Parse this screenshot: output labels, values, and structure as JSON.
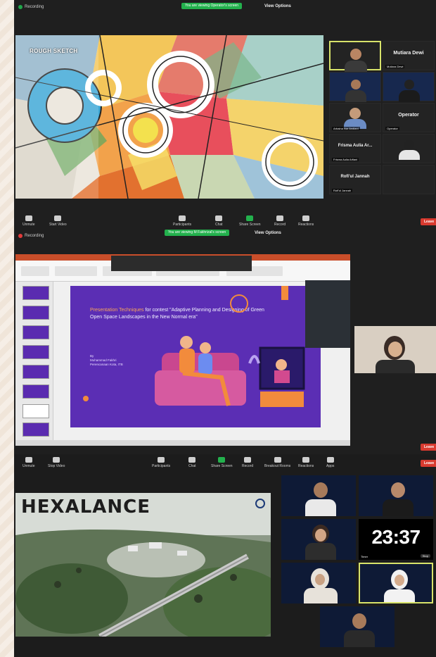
{
  "colors": {
    "zoom_bg": "#1f1f1f",
    "green": "#23b14d",
    "leave": "#d83a2f",
    "slide_purple": "#5b2eb4",
    "accent_orange": "#f6a35c",
    "active_border": "#d8e36a"
  },
  "panel1": {
    "recording": "Recording",
    "banner": "You are viewing Operator's screen",
    "view_options": "View Options",
    "share_label": "ROUGH SKETCH",
    "tiles": [
      {
        "name": "",
        "big": ""
      },
      {
        "name": "Mutiara Dewi",
        "big": "Mutiara Dewi"
      },
      {
        "name": "",
        "big": ""
      },
      {
        "name": "",
        "big": ""
      },
      {
        "name": "Arbaina Nur Andiani",
        "big": ""
      },
      {
        "name": "Operator",
        "big": "Operator"
      },
      {
        "name": "Frisma Aulia Arfiani",
        "big": "Frisma Aulia Ar..."
      },
      {
        "name": "",
        "big": ""
      },
      {
        "name": "Rofi'ul Jannah",
        "big": "Rofi'ul Jannah"
      },
      {
        "name": "",
        "big": ""
      }
    ],
    "toolbar": [
      {
        "label": "Unmute",
        "icon": "microphone-icon"
      },
      {
        "label": "Start Video",
        "icon": "video-camera-icon"
      },
      {
        "label": "Participants",
        "icon": "participants-icon"
      },
      {
        "label": "Chat",
        "icon": "chat-icon"
      },
      {
        "label": "Share Screen",
        "icon": "share-screen-icon"
      },
      {
        "label": "Record",
        "icon": "record-icon"
      },
      {
        "label": "Reactions",
        "icon": "reactions-icon"
      }
    ],
    "leave": "Leave"
  },
  "panel2": {
    "recording": "Recording",
    "banner": "You are viewing M Fakhrizal's screen",
    "view_options": "View Options",
    "slide": {
      "title_hl": "Presentation Techniques",
      "title_rest": " for contest \"Adaptive Planning and Designing of Green Open Space Landscapes in the New Normal era\"",
      "by": "By",
      "author": "Muhammad Fakhri",
      "role": "Perencanaan Kota, ITB"
    },
    "leave": "Leave"
  },
  "panel3": {
    "toolbar": [
      {
        "label": "Unmute",
        "icon": "microphone-icon"
      },
      {
        "label": "Stop Video",
        "icon": "video-camera-icon"
      },
      {
        "label": "Participants",
        "icon": "participants-icon"
      },
      {
        "label": "Chat",
        "icon": "chat-icon"
      },
      {
        "label": "Share Screen",
        "icon": "share-screen-icon"
      },
      {
        "label": "Record",
        "icon": "record-icon"
      },
      {
        "label": "Breakout Rooms",
        "icon": "breakout-rooms-icon"
      },
      {
        "label": "Reactions",
        "icon": "reactions-icon"
      },
      {
        "label": "Apps",
        "icon": "apps-icon"
      }
    ],
    "leave": "Leave",
    "share_title": "HEXALANCE",
    "timer": "23:37",
    "timer_label": "Timer",
    "timer_btn": "Stop"
  }
}
